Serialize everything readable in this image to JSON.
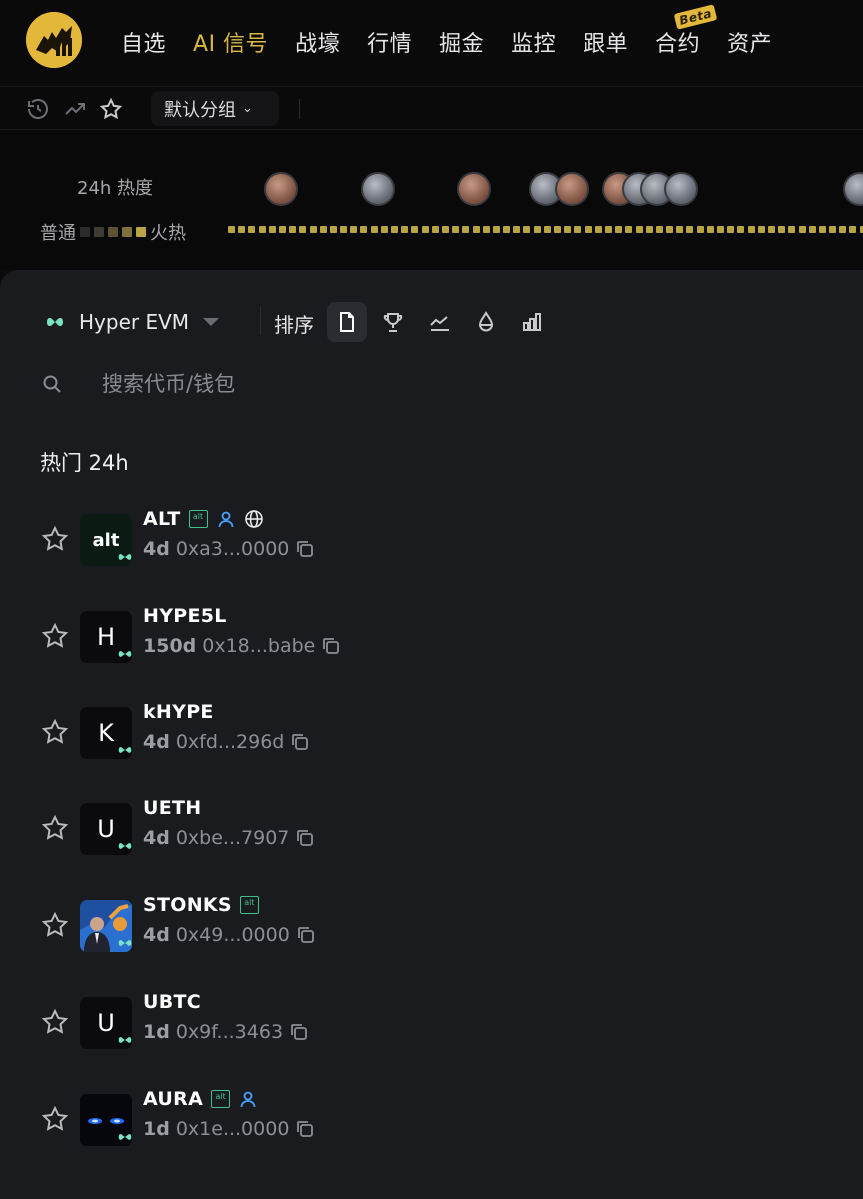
{
  "topnav": {
    "items": [
      {
        "label": "自选"
      },
      {
        "label": "AI 信号"
      },
      {
        "label": "战壕"
      },
      {
        "label": "行情"
      },
      {
        "label": "掘金"
      },
      {
        "label": "监控"
      },
      {
        "label": "跟单"
      },
      {
        "label": "合约",
        "badge": "Beta"
      },
      {
        "label": "资产"
      }
    ],
    "active_index": 1,
    "accent_color": "#d9b844"
  },
  "subbar": {
    "group_label": "默认分组"
  },
  "heat": {
    "label": "24h 热度",
    "scale_low": "普通",
    "scale_high": "火热"
  },
  "panel": {
    "chain_name": "Hyper EVM",
    "sort_label": "排序",
    "search_placeholder": "搜索代币/钱包",
    "section_title": "热门 24h"
  },
  "tokens": [
    {
      "name": "ALT",
      "avatar": "alt",
      "age": "4d",
      "address": "0xa3...0000",
      "alt_tag": "alt",
      "tags": [
        "alt",
        "user-icon",
        "globe-icon"
      ]
    },
    {
      "name": "HYPE5L",
      "avatar": "H",
      "age": "150d",
      "address": "0x18...babe",
      "tags": []
    },
    {
      "name": "kHYPE",
      "avatar": "K",
      "age": "4d",
      "address": "0xfd...296d",
      "tags": []
    },
    {
      "name": "UETH",
      "avatar": "U",
      "age": "4d",
      "address": "0xbe...7907",
      "tags": []
    },
    {
      "name": "STONKS",
      "avatar": "image",
      "age": "4d",
      "address": "0x49...0000",
      "alt_tag": "alt",
      "tags": [
        "alt"
      ]
    },
    {
      "name": "UBTC",
      "avatar": "U",
      "age": "1d",
      "address": "0x9f...3463",
      "tags": []
    },
    {
      "name": "AURA",
      "avatar": "image",
      "age": "1d",
      "address": "0x1e...0000",
      "alt_tag": "alt",
      "tags": [
        "alt",
        "user-icon"
      ]
    }
  ]
}
